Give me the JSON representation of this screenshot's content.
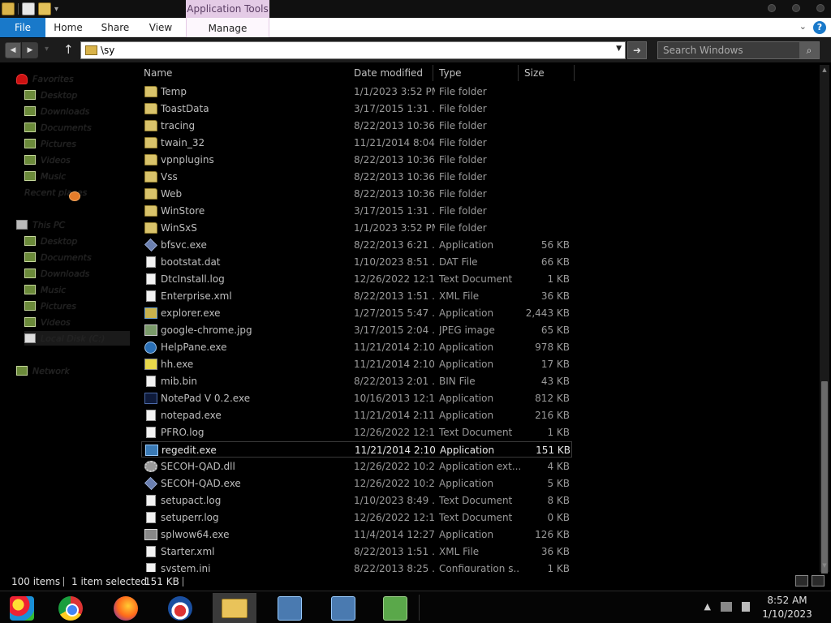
{
  "ribbon": {
    "contextual_group": "Application Tools",
    "tabs": {
      "file": "File",
      "home": "Home",
      "share": "Share",
      "view": "View",
      "manage": "Manage"
    },
    "help": "?",
    "quick_access_dropdown": "▾",
    "collapse_chevron": "⌄"
  },
  "address": {
    "back": "◀",
    "forward": "▶",
    "recent": "▾",
    "up": "↑",
    "path_value": "\\sy",
    "dropdown": "▼",
    "go": "➜"
  },
  "search": {
    "placeholder": "Search Windows",
    "icon": "⌕"
  },
  "nav": {
    "favorites": "Favorites",
    "fav_items": [
      "Desktop",
      "Downloads",
      "Documents",
      "Pictures",
      "Videos",
      "Music",
      "Recent places"
    ],
    "this_pc": "This PC",
    "pc_items": [
      "Desktop",
      "Documents",
      "Downloads",
      "Music",
      "Pictures",
      "Videos",
      "Local Disk (C:)"
    ],
    "network": "Network"
  },
  "columns": {
    "name": "Name",
    "date": "Date modified",
    "type": "Type",
    "size": "Size"
  },
  "sort_mark": "^",
  "files": [
    {
      "name": "Temp",
      "date": "1/1/2023 3:52 PM",
      "type": "File folder",
      "size": "",
      "icon": "folder-icon"
    },
    {
      "name": "ToastData",
      "date": "3/17/2015 1:31 ...",
      "type": "File folder",
      "size": "",
      "icon": "folder-icon"
    },
    {
      "name": "tracing",
      "date": "8/22/2013 10:36...",
      "type": "File folder",
      "size": "",
      "icon": "folder-icon"
    },
    {
      "name": "twain_32",
      "date": "11/21/2014 8:04...",
      "type": "File folder",
      "size": "",
      "icon": "folder-icon"
    },
    {
      "name": "vpnplugins",
      "date": "8/22/2013 10:36...",
      "type": "File folder",
      "size": "",
      "icon": "folder-icon"
    },
    {
      "name": "Vss",
      "date": "8/22/2013 10:36...",
      "type": "File folder",
      "size": "",
      "icon": "folder-icon"
    },
    {
      "name": "Web",
      "date": "8/22/2013 10:36...",
      "type": "File folder",
      "size": "",
      "icon": "folder-icon"
    },
    {
      "name": "WinStore",
      "date": "3/17/2015 1:31 ...",
      "type": "File folder",
      "size": "",
      "icon": "folder-icon"
    },
    {
      "name": "WinSxS",
      "date": "1/1/2023 3:52 PM",
      "type": "File folder",
      "size": "",
      "icon": "folder-icon"
    },
    {
      "name": "bfsvc.exe",
      "date": "8/22/2013 6:21 ...",
      "type": "Application",
      "size": "56 KB",
      "icon": "application-icon"
    },
    {
      "name": "bootstat.dat",
      "date": "1/10/2023 8:51 ...",
      "type": "DAT File",
      "size": "66 KB",
      "icon": "document-icon"
    },
    {
      "name": "DtcInstall.log",
      "date": "12/26/2022 12:1...",
      "type": "Text Document",
      "size": "1 KB",
      "icon": "document-icon"
    },
    {
      "name": "Enterprise.xml",
      "date": "8/22/2013 1:51 ...",
      "type": "XML File",
      "size": "36 KB",
      "icon": "document-icon"
    },
    {
      "name": "explorer.exe",
      "date": "1/27/2015 5:47 ...",
      "type": "Application",
      "size": "2,443 KB",
      "icon": "explorer-app-icon"
    },
    {
      "name": "google-chrome.jpg",
      "date": "3/17/2015 2:04 ...",
      "type": "JPEG image",
      "size": "65 KB",
      "icon": "image-icon"
    },
    {
      "name": "HelpPane.exe",
      "date": "11/21/2014 2:10...",
      "type": "Application",
      "size": "978 KB",
      "icon": "help-icon"
    },
    {
      "name": "hh.exe",
      "date": "11/21/2014 2:10...",
      "type": "Application",
      "size": "17 KB",
      "icon": "help-hint-icon"
    },
    {
      "name": "mib.bin",
      "date": "8/22/2013 2:01 ...",
      "type": "BIN File",
      "size": "43 KB",
      "icon": "document-icon"
    },
    {
      "name": "NotePad V 0.2.exe",
      "date": "10/16/2013 12:1...",
      "type": "Application",
      "size": "812 KB",
      "icon": "notepad-custom-icon"
    },
    {
      "name": "notepad.exe",
      "date": "11/21/2014 2:11...",
      "type": "Application",
      "size": "216 KB",
      "icon": "notepad-icon"
    },
    {
      "name": "PFRO.log",
      "date": "12/26/2022 12:1...",
      "type": "Text Document",
      "size": "1 KB",
      "icon": "document-icon"
    },
    {
      "name": "regedit.exe",
      "date": "11/21/2014 2:10...",
      "type": "Application",
      "size": "151 KB",
      "icon": "registry-icon",
      "selected": true
    },
    {
      "name": "SECOH-QAD.dll",
      "date": "12/26/2022 10:2...",
      "type": "Application ext...",
      "size": "4 KB",
      "icon": "gear-icon"
    },
    {
      "name": "SECOH-QAD.exe",
      "date": "12/26/2022 10:2...",
      "type": "Application",
      "size": "5 KB",
      "icon": "application-icon"
    },
    {
      "name": "setupact.log",
      "date": "1/10/2023 8:49 ...",
      "type": "Text Document",
      "size": "8 KB",
      "icon": "document-icon"
    },
    {
      "name": "setuperr.log",
      "date": "12/26/2022 12:1...",
      "type": "Text Document",
      "size": "0 KB",
      "icon": "document-icon"
    },
    {
      "name": "splwow64.exe",
      "date": "11/4/2014 12:27...",
      "type": "Application",
      "size": "126 KB",
      "icon": "printer-icon"
    },
    {
      "name": "Starter.xml",
      "date": "8/22/2013 1:51 ...",
      "type": "XML File",
      "size": "36 KB",
      "icon": "document-icon"
    },
    {
      "name": "system.ini",
      "date": "8/22/2013 8:25 ...",
      "type": "Configuration s...",
      "size": "1 KB",
      "icon": "document-icon"
    }
  ],
  "status": {
    "items": "100 items",
    "selected": "1 item selected",
    "size": "151 KB"
  },
  "taskbar": {
    "apps": [
      "start-button",
      "chrome",
      "firefox",
      "campaign-app",
      "file-explorer",
      "network-tool-1",
      "network-tool-2",
      "users-app"
    ],
    "tray_up": "▲",
    "time": "8:52 AM",
    "date": "1/10/2023"
  },
  "colors": {
    "file_tab": "#1979ca",
    "app_tools": "#e4cbe6",
    "background": "#000000"
  }
}
